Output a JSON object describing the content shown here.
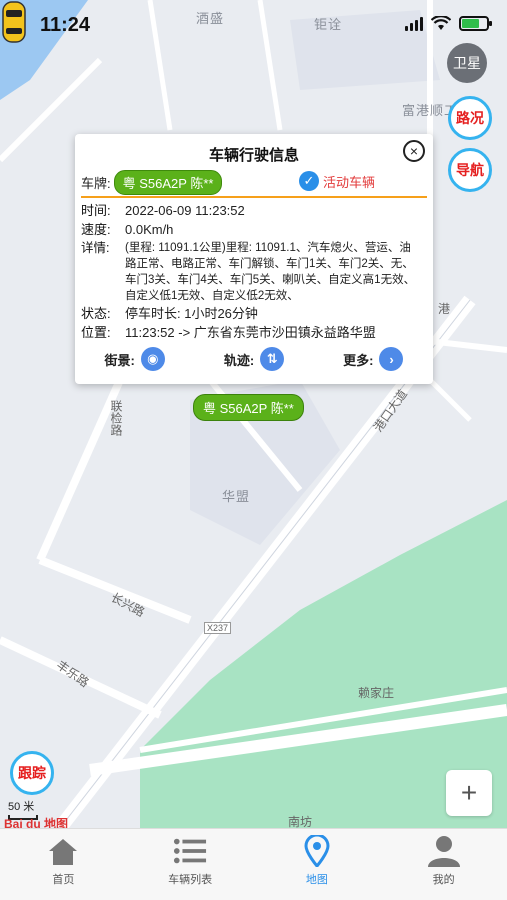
{
  "status_bar": {
    "time": "11:24"
  },
  "map": {
    "satellite_label": "卫星",
    "traffic_label": "路况",
    "navigate_label": "导航",
    "follow_label": "跟踪",
    "zoom_in_label": "+",
    "scale_label": "50 米",
    "logo_text": "Bai du 地图",
    "place_labels": {
      "top1": "酒盛",
      "top2": "钜诠",
      "industrial": "富港顺工业园",
      "huameng": "华盟",
      "lianjian_rd": "联检路",
      "changxing_rd": "长兴路",
      "fengle_rd": "丰乐路",
      "gangkou_rd": "港口大道",
      "gang": "港",
      "zhaojiazhuang": "赖家庄",
      "x237": "X237",
      "south": "南坊"
    }
  },
  "popup": {
    "title": "车辆行驶信息",
    "close_icon": "×",
    "plate_key": "车牌:",
    "plate_value": "粤 S56A2P 陈**",
    "active_label": "活动车辆",
    "rows": {
      "time_key": "时间:",
      "time_val": "2022-06-09 11:23:52",
      "speed_key": "速度:",
      "speed_val": "0.0Km/h",
      "detail_key": "详情:",
      "detail_val": "(里程: 11091.1公里)里程: 11091.1、汽车熄火、营运、油路正常、电路正常、车门解锁、车门1关、车门2关、无、车门3关、车门4关、车门5关、喇叭关、自定义高1无效、自定义低1无效、自定义低2无效、",
      "status_key": "状态:",
      "status_val": "停车时长: 1小时26分钟",
      "location_key": "位置:",
      "location_val": "11:23:52 -> 广东省东莞市沙田镇永益路华盟"
    },
    "actions": {
      "street_label": "街景:",
      "track_label": "轨迹:",
      "more_label": "更多:"
    }
  },
  "vehicle_marker": {
    "label": "粤 S56A2P 陈**"
  },
  "tabbar": {
    "items": [
      {
        "label": "首页"
      },
      {
        "label": "车辆列表"
      },
      {
        "label": "地图"
      },
      {
        "label": "我的"
      }
    ]
  },
  "colors": {
    "accent_blue": "#2a8fe8",
    "plate_green": "#5bb11a",
    "alert_red": "#e52020",
    "divider_orange": "#f6a01a",
    "park_green": "#a8e3c3"
  }
}
